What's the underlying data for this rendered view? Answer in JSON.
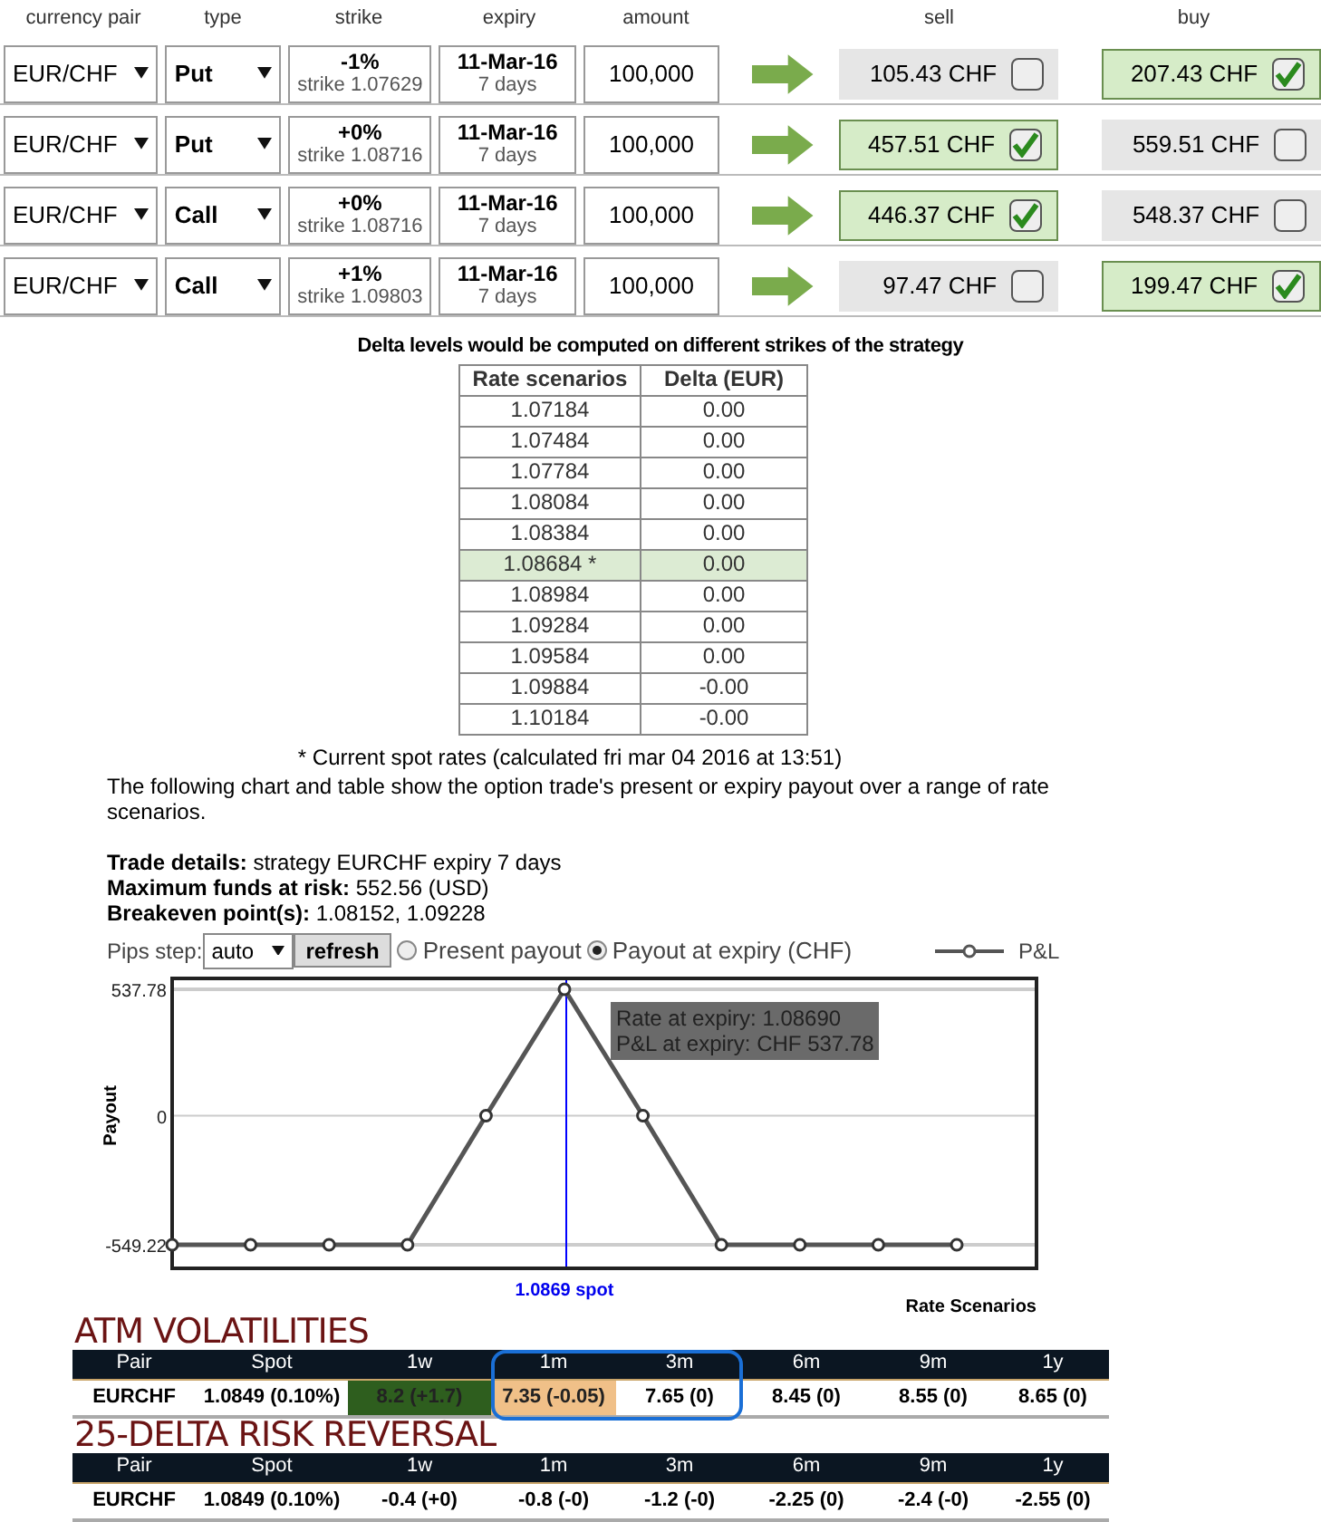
{
  "option_table": {
    "columns": [
      "currency pair",
      "type",
      "strike",
      "expiry",
      "amount",
      "sell",
      "buy"
    ],
    "rows": [
      {
        "pair": "EUR/CHF",
        "type": "Put",
        "strike_pct": "-1%",
        "strike": "strike 1.07629",
        "expiry": "11-Mar-16",
        "days": "7 days",
        "amount": "100,000",
        "sell": {
          "price": "105.43 CHF",
          "checked": false
        },
        "buy": {
          "price": "207.43 CHF",
          "checked": true
        }
      },
      {
        "pair": "EUR/CHF",
        "type": "Put",
        "strike_pct": "+0%",
        "strike": "strike 1.08716",
        "expiry": "11-Mar-16",
        "days": "7 days",
        "amount": "100,000",
        "sell": {
          "price": "457.51 CHF",
          "checked": true
        },
        "buy": {
          "price": "559.51 CHF",
          "checked": false
        }
      },
      {
        "pair": "EUR/CHF",
        "type": "Call",
        "strike_pct": "+0%",
        "strike": "strike 1.08716",
        "expiry": "11-Mar-16",
        "days": "7 days",
        "amount": "100,000",
        "sell": {
          "price": "446.37 CHF",
          "checked": true
        },
        "buy": {
          "price": "548.37 CHF",
          "checked": false
        }
      },
      {
        "pair": "EUR/CHF",
        "type": "Call",
        "strike_pct": "+1%",
        "strike": "strike 1.09803",
        "expiry": "11-Mar-16",
        "days": "7 days",
        "amount": "100,000",
        "sell": {
          "price": "97.47 CHF",
          "checked": false
        },
        "buy": {
          "price": "199.47 CHF",
          "checked": true
        }
      }
    ]
  },
  "delta": {
    "title": "Delta levels would be computed on different strikes of the strategy",
    "columns": [
      "Rate scenarios",
      "Delta (EUR)"
    ],
    "rows": [
      {
        "rate": "1.07184",
        "delta": "0.00",
        "selected": false
      },
      {
        "rate": "1.07484",
        "delta": "0.00",
        "selected": false
      },
      {
        "rate": "1.07784",
        "delta": "0.00",
        "selected": false
      },
      {
        "rate": "1.08084",
        "delta": "0.00",
        "selected": false
      },
      {
        "rate": "1.08384",
        "delta": "0.00",
        "selected": false
      },
      {
        "rate": "1.08684 *",
        "delta": "0.00",
        "selected": true
      },
      {
        "rate": "1.08984",
        "delta": "0.00",
        "selected": false
      },
      {
        "rate": "1.09284",
        "delta": "0.00",
        "selected": false
      },
      {
        "rate": "1.09584",
        "delta": "0.00",
        "selected": false
      },
      {
        "rate": "1.09884",
        "delta": "-0.00",
        "selected": false
      },
      {
        "rate": "1.10184",
        "delta": "-0.00",
        "selected": false
      }
    ],
    "footnote": "* Current spot rates (calculated fri mar 04 2016 at 13:51)"
  },
  "description": "The following chart and table show the option trade's present or expiry payout over a range of rate scenarios.",
  "trade_details": [
    "**Trade details:** strategy EURCHF expiry 7 days",
    "**Maximum funds at risk:** 552.56 (USD)",
    "**Breakeven point(s):** 1.08152, 1.09228"
  ],
  "controls": {
    "pips_label": "Pips step:",
    "pips_value": "auto",
    "refresh": "refresh",
    "radios": [
      {
        "label": "Present payout",
        "selected": false
      },
      {
        "label": "Payout at expiry (CHF)",
        "selected": true
      }
    ]
  },
  "chart_data": {
    "type": "line",
    "ylabel": "Payout",
    "xlabel": "Rate Scenarios",
    "ylim": [
      -549.22,
      537.78
    ],
    "yticks": [
      {
        "value": -549.22,
        "label": "-549.22"
      },
      {
        "value": 0,
        "label": "0"
      },
      {
        "value": 537.78,
        "label": "537.78"
      }
    ],
    "series": [
      {
        "name": "P&L",
        "color": "#555555",
        "marker": "circle",
        "values": [
          -549.22,
          -549.22,
          -549.22,
          -549.22,
          0,
          537.78,
          0,
          -549.22,
          -549.22,
          -549.22,
          -549.22
        ]
      }
    ],
    "annotations": [
      "1.0869 spot",
      "Rate at expiry: 1.08690",
      "P&L at expiry: CHF 537.78"
    ]
  },
  "vol_tables": [
    {
      "title": "ATM VOLATILITIES",
      "columns": [
        {
          "label": "Pair",
          "circled": false
        },
        {
          "label": "Spot",
          "circled": false
        },
        {
          "label": "1w",
          "circled": false
        },
        {
          "label": "1m",
          "circled": true
        },
        {
          "label": "3m",
          "circled": true
        },
        {
          "label": "6m",
          "circled": false
        },
        {
          "label": "9m",
          "circled": false
        },
        {
          "label": "1y",
          "circled": false
        }
      ],
      "cells": [
        {
          "text": "EURCHF"
        },
        {
          "text": "1.0849 (0.10%)"
        },
        {
          "text": "8.2 (+1.7)",
          "color": "#2e5e1e"
        },
        {
          "text": "7.35 (-0.05)",
          "color": "#f0c088"
        },
        {
          "text": "7.65 (0)"
        },
        {
          "text": "8.45 (0)"
        },
        {
          "text": "8.55 (0)"
        },
        {
          "text": "8.65 (0)"
        }
      ]
    },
    {
      "title": "25-DELTA RISK REVERSAL",
      "columns": [
        {
          "label": "Pair",
          "circled": false
        },
        {
          "label": "Spot",
          "circled": false
        },
        {
          "label": "1w",
          "circled": false
        },
        {
          "label": "1m",
          "circled": false
        },
        {
          "label": "3m",
          "circled": false
        },
        {
          "label": "6m",
          "circled": false
        },
        {
          "label": "9m",
          "circled": false
        },
        {
          "label": "1y",
          "circled": false
        }
      ],
      "cells": [
        {
          "text": "EURCHF"
        },
        {
          "text": "1.0849 (0.10%)"
        },
        {
          "text": "-0.4 (+0)"
        },
        {
          "text": "-0.8 (-0)"
        },
        {
          "text": "-1.2 (-0)"
        },
        {
          "text": "-2.25 (0)"
        },
        {
          "text": "-2.4 (-0)"
        },
        {
          "text": "-2.55 (0)"
        }
      ]
    }
  ]
}
